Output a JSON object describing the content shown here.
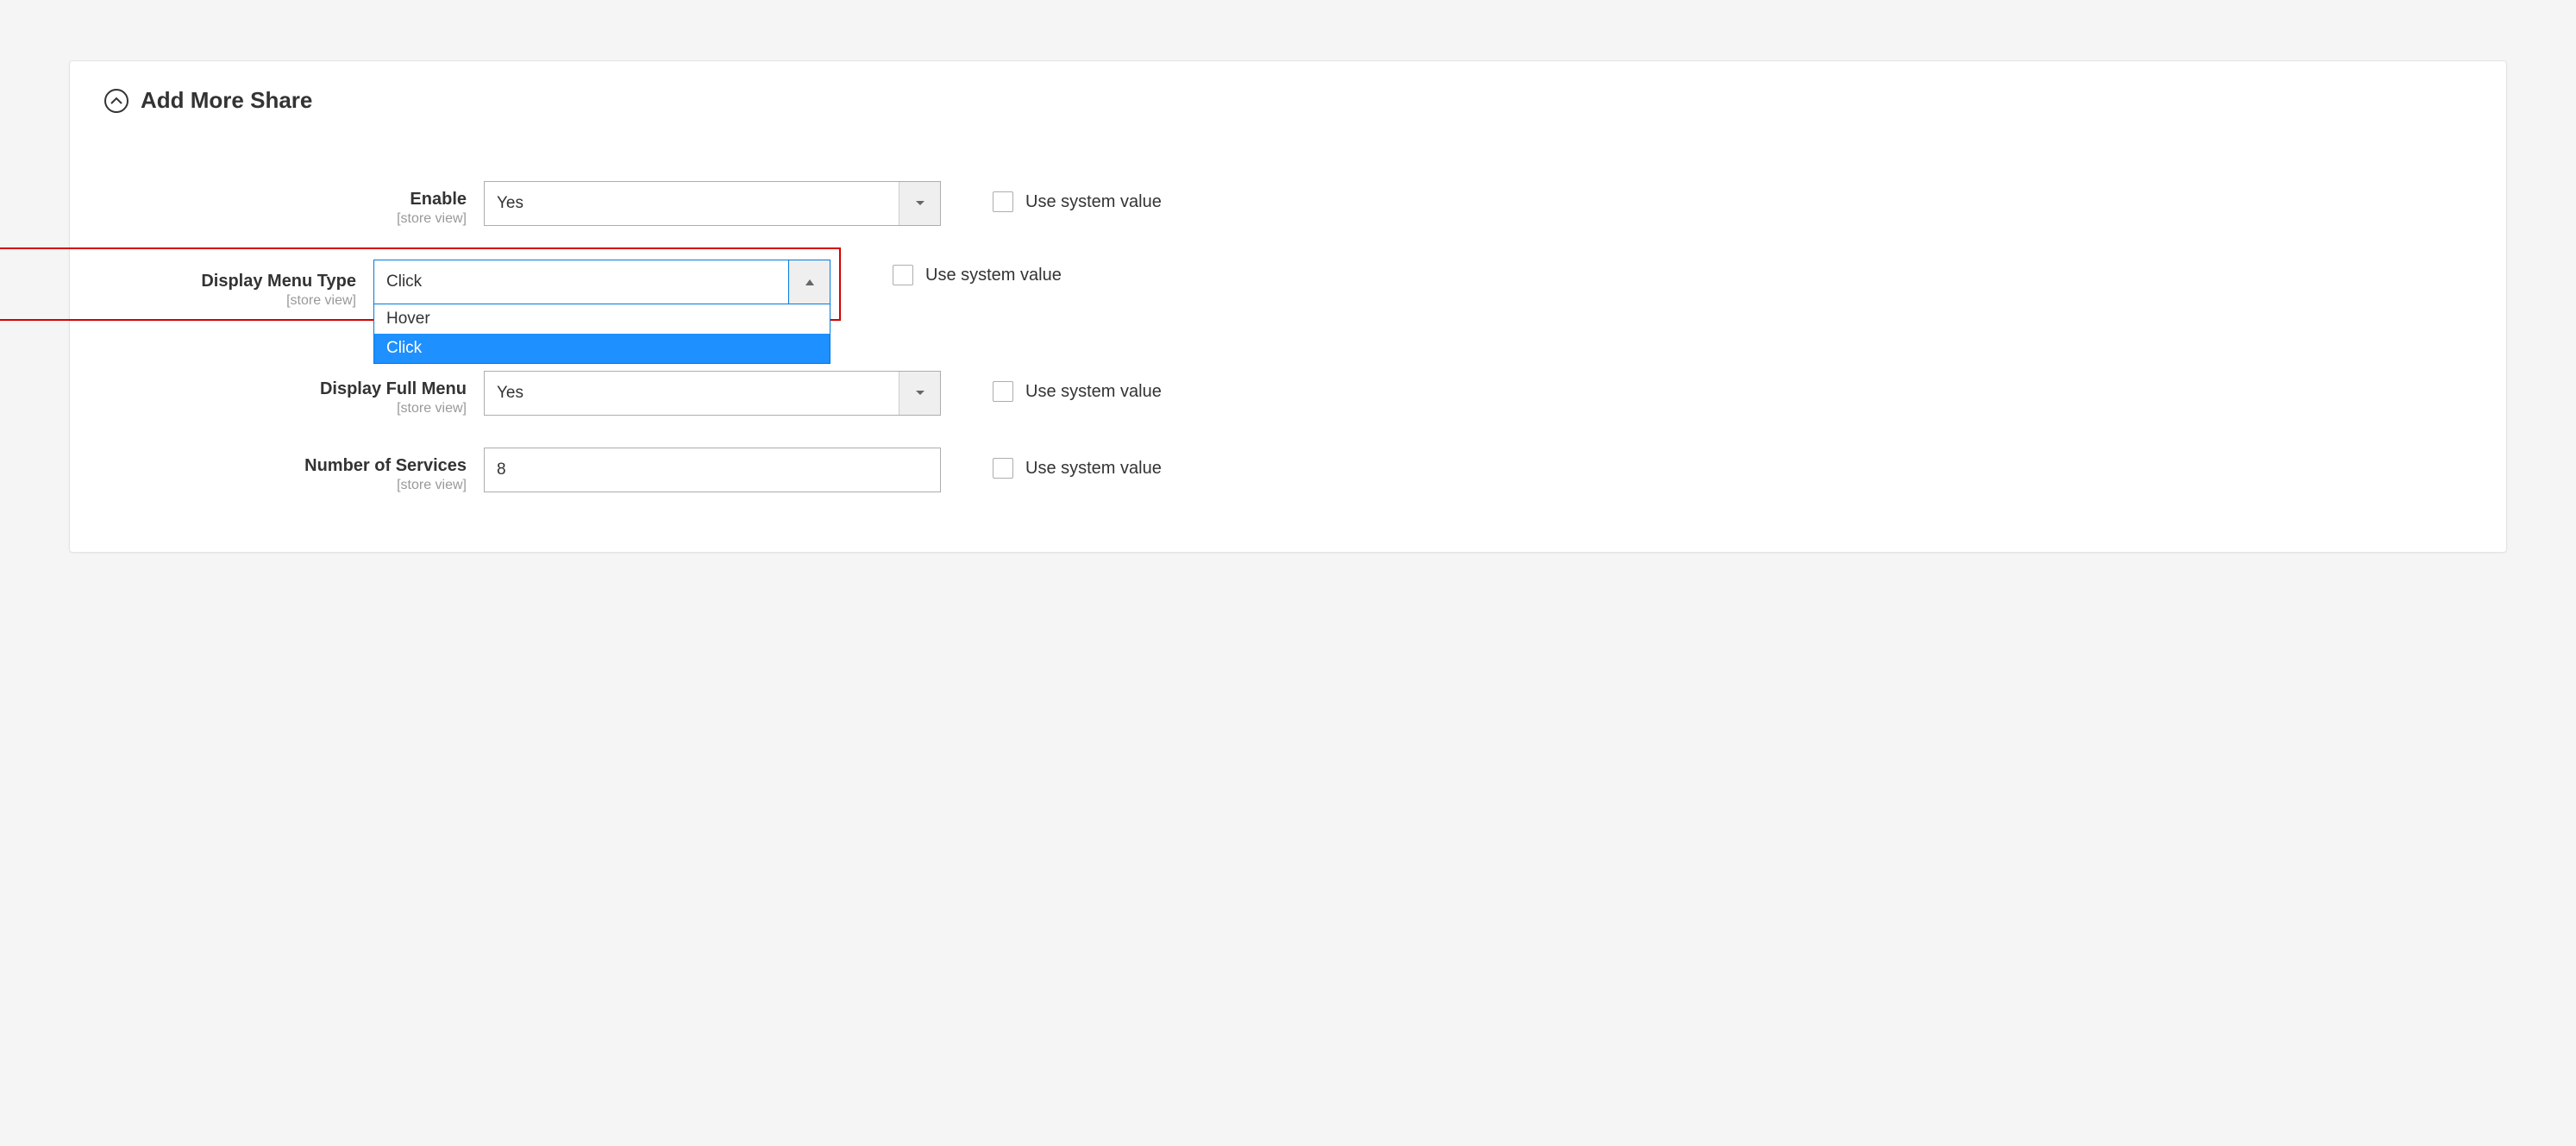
{
  "section": {
    "title": "Add More Share"
  },
  "scope_label": "[store view]",
  "use_system_value_label": "Use system value",
  "fields": {
    "enable": {
      "label": "Enable",
      "value": "Yes"
    },
    "display_menu_type": {
      "label": "Display Menu Type",
      "value": "Click",
      "options": [
        "Hover",
        "Click"
      ]
    },
    "display_full_menu": {
      "label": "Display Full Menu",
      "value": "Yes"
    },
    "number_of_services": {
      "label": "Number of Services",
      "value": "8"
    }
  }
}
